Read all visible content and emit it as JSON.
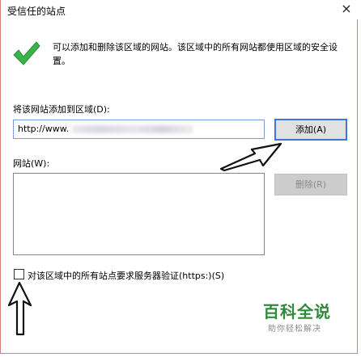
{
  "window": {
    "title": "受信任的站点",
    "close_glyph": "×"
  },
  "info": {
    "text": "可以添加和删除该区域的网站。该区域中的所有网站都使用区域的安全设置。",
    "icon": "check-icon",
    "icon_color": "#3ab34a"
  },
  "add_site": {
    "label": "将该网站添加到区域(D):",
    "input_value": "http://www.",
    "button_label": "添加(A)"
  },
  "sites": {
    "label": "网站(W):",
    "items": [],
    "remove_button_label": "删除(R)"
  },
  "https_option": {
    "label": "对该区域中的所有站点要求服务器验证(https:)(S)",
    "checked": false
  },
  "watermark": {
    "title": "百科全说",
    "subtitle": "助你轻松解决"
  },
  "colors": {
    "accent": "#3a78d4",
    "window_border": "#d4826f"
  }
}
